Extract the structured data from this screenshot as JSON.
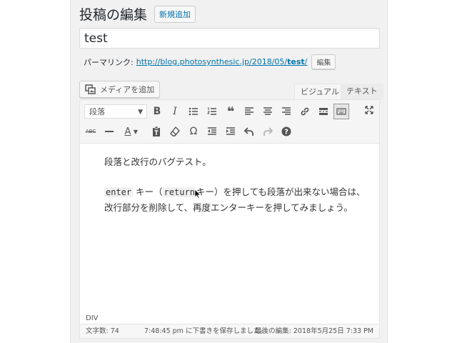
{
  "header": {
    "title": "投稿の編集",
    "add_new": "新規追加"
  },
  "post": {
    "title": "test"
  },
  "permalink": {
    "label": "パーマリンク:",
    "url_base": "http://blog.photosynthesic.jp/2018/05/",
    "slug": "test",
    "trailing": "/",
    "edit_label": "編集"
  },
  "media": {
    "add_label": "メディアを追加"
  },
  "tabs": {
    "visual": "ビジュアル",
    "text": "テキスト"
  },
  "toolbar": {
    "format_value": "段落",
    "row1_icons": [
      "bold-icon",
      "italic-icon",
      "bulleted-list-icon",
      "numbered-list-icon",
      "blockquote-icon",
      "align-left-icon",
      "align-center-icon",
      "align-right-icon",
      "link-icon",
      "read-more-icon",
      "toolbar-toggle-icon",
      "fullscreen-icon"
    ],
    "row2_icons": [
      "strikethrough-icon",
      "horizontal-line-icon",
      "text-color-icon",
      "paste-text-icon",
      "clear-formatting-icon",
      "special-character-icon",
      "outdent-icon",
      "indent-icon",
      "undo-icon",
      "redo-icon",
      "help-icon"
    ]
  },
  "content": {
    "para1": "段落と改行のバグテスト。",
    "code1": "enter",
    "text1": " キー（",
    "code2": "return",
    "text2": "キー）を押しても段落が出来ない場合は、改行部分を削除して、再度エンターキーを押してみましょう。"
  },
  "path": "DIV",
  "status": {
    "word_count": "文字数: 74",
    "autosave": "7:48:45 pm に下書きを保存しました。",
    "last_edit": "最後の編集: 2018年5月25日 7:33 PM"
  },
  "colors": {
    "link": "#0073aa",
    "background": "#f1f1f1",
    "toolbar": "#f5f5f5"
  }
}
